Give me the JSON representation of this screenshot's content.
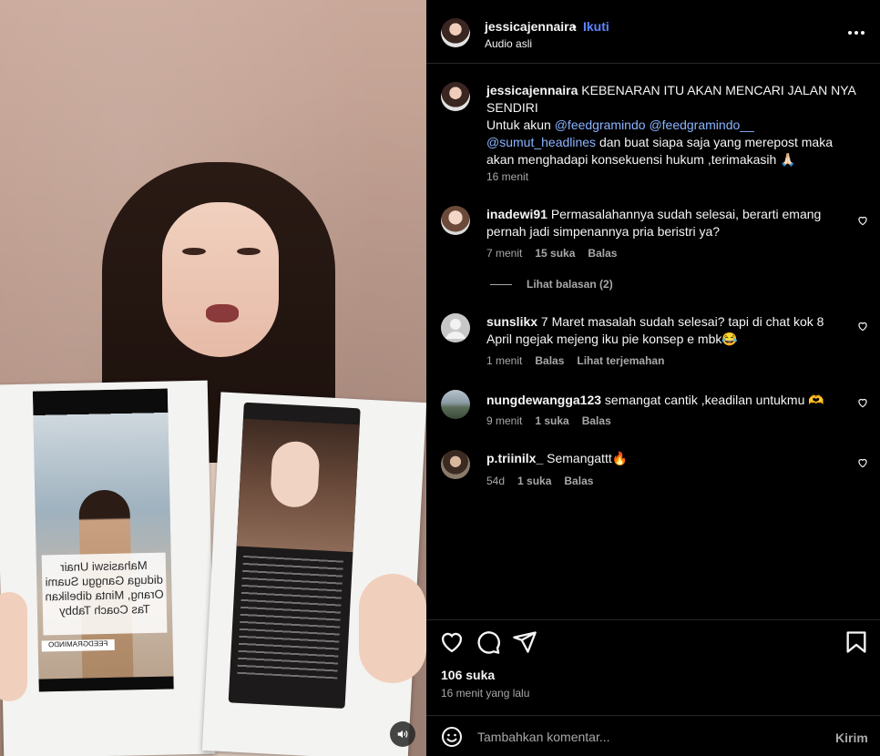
{
  "post": {
    "username": "jessicajennaira",
    "dot": "•",
    "follow_label": "Ikuti",
    "audio": "Audio asli",
    "more_icon": "more-horizontal-icon"
  },
  "caption": {
    "username": "jessicajennaira",
    "text_1": "KEBENARAN ITU AKAN MENCARI JALAN NYA SENDIRI",
    "text_2": "Untuk akun",
    "mention_1": "@feedgramindo",
    "mention_2": "@feedgramindo__",
    "mention_3": "@sumut_headlines",
    "text_3": "dan buat siapa saja yang merepost maka akan menghadapi konsekuensi hukum ,terimakasih 🙏🏻",
    "time": "16 menit"
  },
  "comments": [
    {
      "username": "inadewi91",
      "text": "Permasalahannya sudah selesai, berarti emang pernah jadi simpenannya pria beristri ya?",
      "time": "7 menit",
      "likes": "15 suka",
      "reply": "Balas",
      "view_replies": "Lihat balasan (2)"
    },
    {
      "username": "sunslikx",
      "text": "7 Maret masalah sudah selesai? tapi di chat kok 8 April ngejak mejeng iku pie konsep e mbk😂",
      "time": "1 menit",
      "reply": "Balas",
      "translate": "Lihat terjemahan"
    },
    {
      "username": "nungdewangga123",
      "text": "semangat cantik ,keadilan untukmu 🫶",
      "time": "9 menit",
      "likes": "1 suka",
      "reply": "Balas"
    },
    {
      "username": "p.triinilx_",
      "text": "Semangattt🔥",
      "time": "54d",
      "likes": "1 suka",
      "reply": "Balas"
    }
  ],
  "media": {
    "print_caption": "Mahasiswi Unair diduga Ganggu Suami Orang, Minta dibelikan Tas Coach Tabby",
    "print_tag": "FEEDGRAMINDO"
  },
  "actions": {
    "likes": "106 suka",
    "ago": "16 menit yang lalu"
  },
  "composer": {
    "placeholder": "Tambahkan komentar...",
    "post_label": "Kirim"
  },
  "colors": {
    "accent": "#5c86ff",
    "mention": "#8ab4ff",
    "muted": "#a8a8a8",
    "background": "#000000"
  }
}
